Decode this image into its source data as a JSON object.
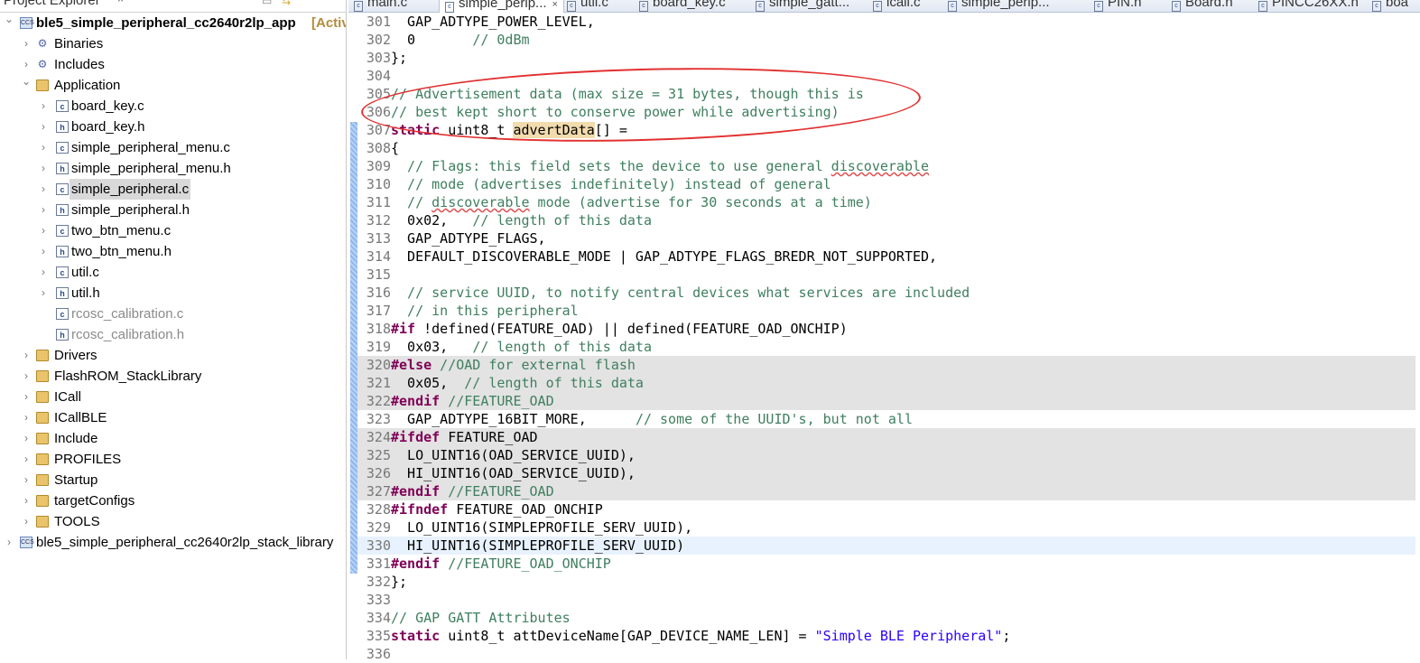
{
  "explorer": {
    "title": "Project Explorer",
    "close": "×",
    "tree": [
      {
        "label": "ble5_simple_peripheral_cc2640r2lp_app",
        "suffix": "[Active",
        "level": 0,
        "arrow": "v",
        "icon": "proj",
        "bold": true
      },
      {
        "label": "Binaries",
        "level": 1,
        "arrow": ">",
        "icon": "bin"
      },
      {
        "label": "Includes",
        "level": 1,
        "arrow": ">",
        "icon": "bin"
      },
      {
        "label": "Application",
        "level": 1,
        "arrow": "v",
        "icon": "folder"
      },
      {
        "label": "board_key.c",
        "level": 2,
        "arrow": ">",
        "icon": "file",
        "mark": "c"
      },
      {
        "label": "board_key.h",
        "level": 2,
        "arrow": ">",
        "icon": "file",
        "mark": "h"
      },
      {
        "label": "simple_peripheral_menu.c",
        "level": 2,
        "arrow": ">",
        "icon": "file",
        "mark": "c"
      },
      {
        "label": "simple_peripheral_menu.h",
        "level": 2,
        "arrow": ">",
        "icon": "file",
        "mark": "h"
      },
      {
        "label": "simple_peripheral.c",
        "level": 2,
        "arrow": ">",
        "icon": "file",
        "mark": "c",
        "selected": true
      },
      {
        "label": "simple_peripheral.h",
        "level": 2,
        "arrow": ">",
        "icon": "file",
        "mark": "h"
      },
      {
        "label": "two_btn_menu.c",
        "level": 2,
        "arrow": ">",
        "icon": "file",
        "mark": "c"
      },
      {
        "label": "two_btn_menu.h",
        "level": 2,
        "arrow": ">",
        "icon": "file",
        "mark": "h"
      },
      {
        "label": "util.c",
        "level": 2,
        "arrow": ">",
        "icon": "file",
        "mark": "c"
      },
      {
        "label": "util.h",
        "level": 2,
        "arrow": ">",
        "icon": "file",
        "mark": "h"
      },
      {
        "label": "rcosc_calibration.c",
        "level": 2,
        "arrow": "",
        "icon": "file",
        "mark": "c",
        "grey": true
      },
      {
        "label": "rcosc_calibration.h",
        "level": 2,
        "arrow": "",
        "icon": "file",
        "mark": "h",
        "grey": true
      },
      {
        "label": "Drivers",
        "level": 1,
        "arrow": ">",
        "icon": "folder"
      },
      {
        "label": "FlashROM_StackLibrary",
        "level": 1,
        "arrow": ">",
        "icon": "folder"
      },
      {
        "label": "ICall",
        "level": 1,
        "arrow": ">",
        "icon": "folder"
      },
      {
        "label": "ICallBLE",
        "level": 1,
        "arrow": ">",
        "icon": "folder"
      },
      {
        "label": "Include",
        "level": 1,
        "arrow": ">",
        "icon": "folder"
      },
      {
        "label": "PROFILES",
        "level": 1,
        "arrow": ">",
        "icon": "folder"
      },
      {
        "label": "Startup",
        "level": 1,
        "arrow": ">",
        "icon": "folder"
      },
      {
        "label": "targetConfigs",
        "level": 1,
        "arrow": ">",
        "icon": "folder"
      },
      {
        "label": "TOOLS",
        "level": 1,
        "arrow": ">",
        "icon": "folder"
      },
      {
        "label": "ble5_simple_peripheral_cc2640r2lp_stack_library",
        "level": 0,
        "arrow": ">",
        "icon": "proj"
      }
    ]
  },
  "tabs": [
    {
      "label": "main.c"
    },
    {
      "label": "simple_perip...",
      "active": true,
      "close": "×"
    },
    {
      "label": "util.c"
    },
    {
      "label": "board_key.c"
    },
    {
      "label": "simple_gatt..."
    },
    {
      "label": "icall.c"
    },
    {
      "label": "simple_perip..."
    },
    {
      "label": "PIN.h"
    },
    {
      "label": "Board.h"
    },
    {
      "label": "PINCC26XX.h"
    },
    {
      "label": "boa"
    }
  ],
  "code": [
    {
      "n": "301",
      "seg": [
        [
          "  GAP_ADTYPE_POWER_LEVEL,",
          ""
        ]
      ]
    },
    {
      "n": "302",
      "seg": [
        [
          "  0       ",
          ""
        ],
        [
          "// 0dBm",
          "c"
        ]
      ]
    },
    {
      "n": "303",
      "seg": [
        [
          "};",
          ""
        ]
      ]
    },
    {
      "n": "304",
      "seg": []
    },
    {
      "n": "305",
      "seg": [
        [
          "// Advertisement data (max size = 31 bytes, though this is",
          "c"
        ]
      ]
    },
    {
      "n": "306",
      "seg": [
        [
          "// best kept short to conserve power while advertising)",
          "c"
        ]
      ]
    },
    {
      "n": "307",
      "seg": [
        [
          "static",
          "k"
        ],
        [
          " uint8_t ",
          ""
        ],
        [
          "advertData",
          "h"
        ],
        [
          "[] =",
          ""
        ]
      ]
    },
    {
      "n": "308",
      "seg": [
        [
          "{",
          ""
        ]
      ]
    },
    {
      "n": "309",
      "seg": [
        [
          "  // Flags: this field sets the device to use general ",
          "c"
        ],
        [
          "discoverable",
          "c sq"
        ]
      ]
    },
    {
      "n": "310",
      "seg": [
        [
          "  // mode (advertises indefinitely) instead of general",
          "c"
        ]
      ]
    },
    {
      "n": "311",
      "seg": [
        [
          "  // ",
          "c"
        ],
        [
          "discoverable",
          "c sq"
        ],
        [
          " mode (advertise for 30 seconds at a time)",
          "c"
        ]
      ]
    },
    {
      "n": "312",
      "seg": [
        [
          "  0x02,   ",
          ""
        ],
        [
          "// length of this data",
          "c"
        ]
      ]
    },
    {
      "n": "313",
      "seg": [
        [
          "  GAP_ADTYPE_FLAGS,",
          ""
        ]
      ]
    },
    {
      "n": "314",
      "seg": [
        [
          "  DEFAULT_DISCOVERABLE_MODE | GAP_ADTYPE_FLAGS_BREDR_NOT_SUPPORTED,",
          ""
        ]
      ]
    },
    {
      "n": "315",
      "seg": []
    },
    {
      "n": "316",
      "seg": [
        [
          "  // service UUID, to notify central devices what services are included",
          "c"
        ]
      ]
    },
    {
      "n": "317",
      "seg": [
        [
          "  // in this peripheral",
          "c"
        ]
      ]
    },
    {
      "n": "318",
      "seg": [
        [
          "#if",
          "k"
        ],
        [
          " !defined(FEATURE_OAD) || defined(FEATURE_OAD_ONCHIP)",
          ""
        ]
      ]
    },
    {
      "n": "319",
      "seg": [
        [
          "  0x03,   ",
          ""
        ],
        [
          "// length of this data",
          "c"
        ]
      ]
    },
    {
      "n": "320",
      "inactive": true,
      "seg": [
        [
          "#else",
          "k"
        ],
        [
          " //OAD for external flash",
          "c"
        ]
      ]
    },
    {
      "n": "321",
      "inactive": true,
      "seg": [
        [
          "  0x05,  ",
          ""
        ],
        [
          "// length of this data",
          "c"
        ]
      ]
    },
    {
      "n": "322",
      "inactive": true,
      "seg": [
        [
          "#endif",
          "k"
        ],
        [
          " //FEATURE_OAD",
          "c"
        ]
      ]
    },
    {
      "n": "323",
      "seg": [
        [
          "  GAP_ADTYPE_16BIT_MORE,      ",
          ""
        ],
        [
          "// some of the UUID's, but not all",
          "c"
        ]
      ]
    },
    {
      "n": "324",
      "inactive": true,
      "seg": [
        [
          "#ifdef",
          "k"
        ],
        [
          " FEATURE_OAD",
          ""
        ]
      ]
    },
    {
      "n": "325",
      "inactive": true,
      "seg": [
        [
          "  LO_UINT16(OAD_SERVICE_UUID),",
          ""
        ]
      ]
    },
    {
      "n": "326",
      "inactive": true,
      "seg": [
        [
          "  HI_UINT16(OAD_SERVICE_UUID),",
          ""
        ]
      ]
    },
    {
      "n": "327",
      "inactive": true,
      "seg": [
        [
          "#endif",
          "k"
        ],
        [
          " //FEATURE_OAD",
          "c"
        ]
      ]
    },
    {
      "n": "328",
      "seg": [
        [
          "#ifndef",
          "k"
        ],
        [
          " FEATURE_OAD_ONCHIP",
          ""
        ]
      ]
    },
    {
      "n": "329",
      "seg": [
        [
          "  LO_UINT16(SIMPLEPROFILE_SERV_UUID),",
          ""
        ]
      ]
    },
    {
      "n": "330",
      "current": true,
      "seg": [
        [
          "  HI_UINT16(SIMPLEPROFILE_SERV_UUID)",
          ""
        ]
      ]
    },
    {
      "n": "331",
      "seg": [
        [
          "#endif",
          "k"
        ],
        [
          " //FEATURE_OAD_ONCHIP",
          "c"
        ]
      ]
    },
    {
      "n": "332",
      "seg": [
        [
          "};",
          ""
        ]
      ]
    },
    {
      "n": "333",
      "seg": []
    },
    {
      "n": "334",
      "seg": [
        [
          "// GAP GATT Attributes",
          "c"
        ]
      ]
    },
    {
      "n": "335",
      "seg": [
        [
          "static",
          "k"
        ],
        [
          " uint8_t attDeviceName[GAP_DEVICE_NAME_LEN] = ",
          ""
        ],
        [
          "\"Simple BLE Peripheral\"",
          "s"
        ],
        [
          ";",
          ""
        ]
      ]
    },
    {
      "n": "336",
      "seg": []
    }
  ]
}
